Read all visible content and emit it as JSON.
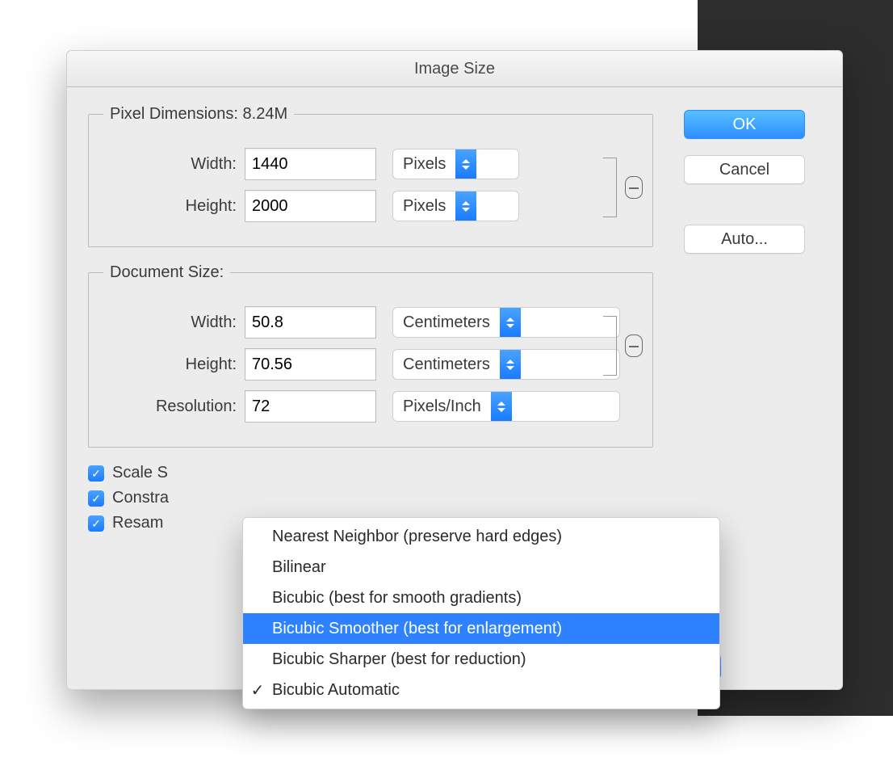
{
  "dialog": {
    "title": "Image Size",
    "pixel_dimensions": {
      "legend_prefix": "Pixel Dimensions:  ",
      "size_text": "8.24M",
      "width_label": "Width:",
      "width_value": "1440",
      "width_unit": "Pixels",
      "height_label": "Height:",
      "height_value": "2000",
      "height_unit": "Pixels"
    },
    "document_size": {
      "legend": "Document Size:",
      "width_label": "Width:",
      "width_value": "50.8",
      "width_unit": "Centimeters",
      "height_label": "Height:",
      "height_value": "70.56",
      "height_unit": "Centimeters",
      "resolution_label": "Resolution:",
      "resolution_value": "72",
      "resolution_unit": "Pixels/Inch"
    },
    "checkboxes": {
      "scale_styles": "Scale Styles",
      "constrain": "Constrain Proportions",
      "resample": "Resample Image:",
      "scale_styles_visible": "Scale S",
      "constrain_visible": "Constra",
      "resample_visible": "Resam"
    },
    "buttons": {
      "ok": "OK",
      "cancel": "Cancel",
      "auto": "Auto..."
    }
  },
  "menu": {
    "items": [
      {
        "label": "Nearest Neighbor (preserve hard edges)",
        "checked": false,
        "highlighted": false
      },
      {
        "label": "Bilinear",
        "checked": false,
        "highlighted": false
      },
      {
        "label": "Bicubic (best for smooth gradients)",
        "checked": false,
        "highlighted": false
      },
      {
        "label": "Bicubic Smoother (best for enlargement)",
        "checked": false,
        "highlighted": true
      },
      {
        "label": "Bicubic Sharper (best for reduction)",
        "checked": false,
        "highlighted": false
      },
      {
        "label": "Bicubic Automatic",
        "checked": true,
        "highlighted": false
      }
    ]
  }
}
